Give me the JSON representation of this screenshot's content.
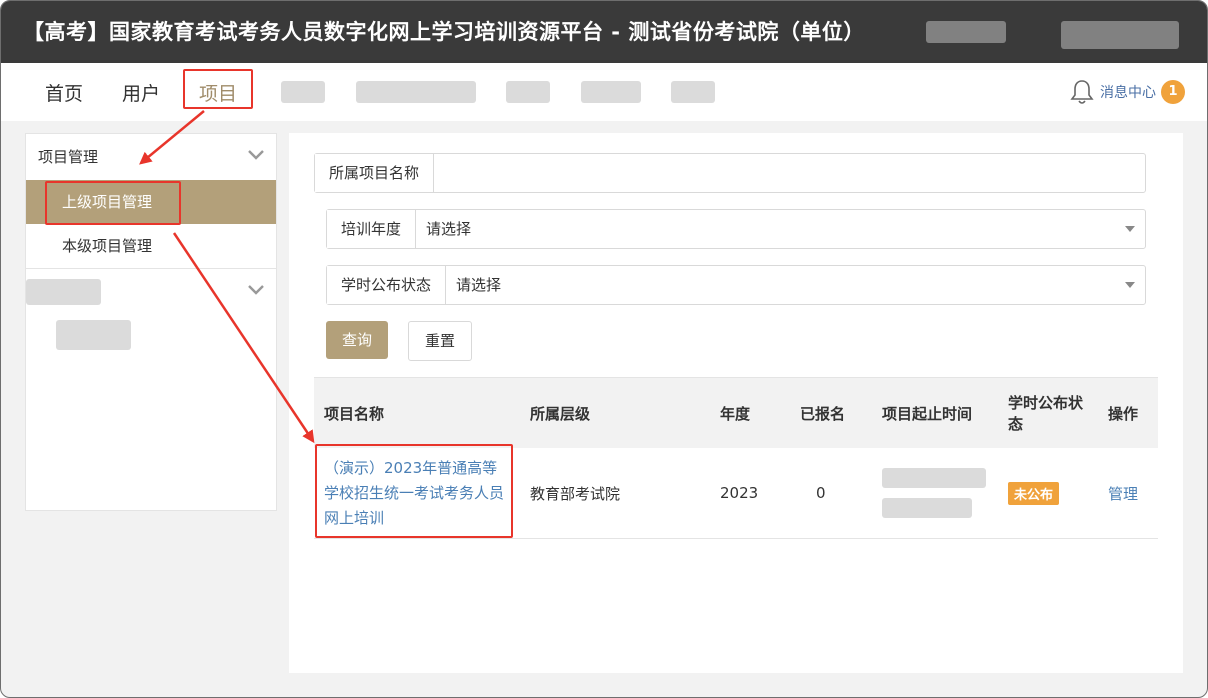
{
  "window": {
    "title": "【高考】国家教育考试考务人员数字化网上学习培训资源平台 - 测试省份考试院（单位）"
  },
  "nav": {
    "items": [
      "首页",
      "用户",
      "项目"
    ],
    "active_index": 2,
    "message_center": "消息中心",
    "message_count": "1"
  },
  "sidebar": {
    "group_title": "项目管理",
    "items": [
      "上级项目管理",
      "本级项目管理"
    ],
    "active_index": 0
  },
  "filters": {
    "project_name_label": "所属项目名称",
    "project_name_value": "",
    "year_label": "培训年度",
    "year_value": "请选择",
    "status_label": "学时公布状态",
    "status_value": "请选择",
    "query_button": "查询",
    "reset_button": "重置"
  },
  "table": {
    "headers": [
      "项目名称",
      "所属层级",
      "年度",
      "已报名",
      "项目起止时间",
      "学时公布状态",
      "操作"
    ],
    "rows": [
      {
        "name": "（演示）2023年普通高等学校招生统一考试考务人员网上培训",
        "level": "教育部考试院",
        "year": "2023",
        "enrolled": "0",
        "status": "未公布",
        "action": "管理"
      }
    ]
  },
  "colors": {
    "accent": "#b3a07a",
    "badge": "#f0a23b",
    "link": "#4a7fb5",
    "annotation": "#e8352b"
  }
}
